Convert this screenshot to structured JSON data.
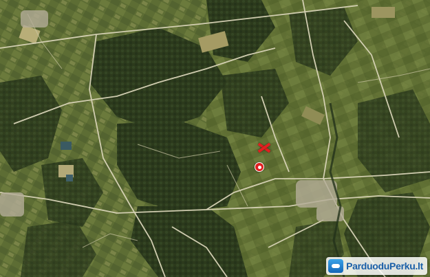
{
  "map": {
    "type": "satellite-view",
    "markers": [
      {
        "icon": "location-pin-icon",
        "color": "#e02020"
      },
      {
        "icon": "x-cross-icon",
        "color": "#e02020"
      }
    ]
  },
  "watermark": {
    "icon": "parduoduperku-logo-icon",
    "text": "ParduoduPerku.lt"
  }
}
